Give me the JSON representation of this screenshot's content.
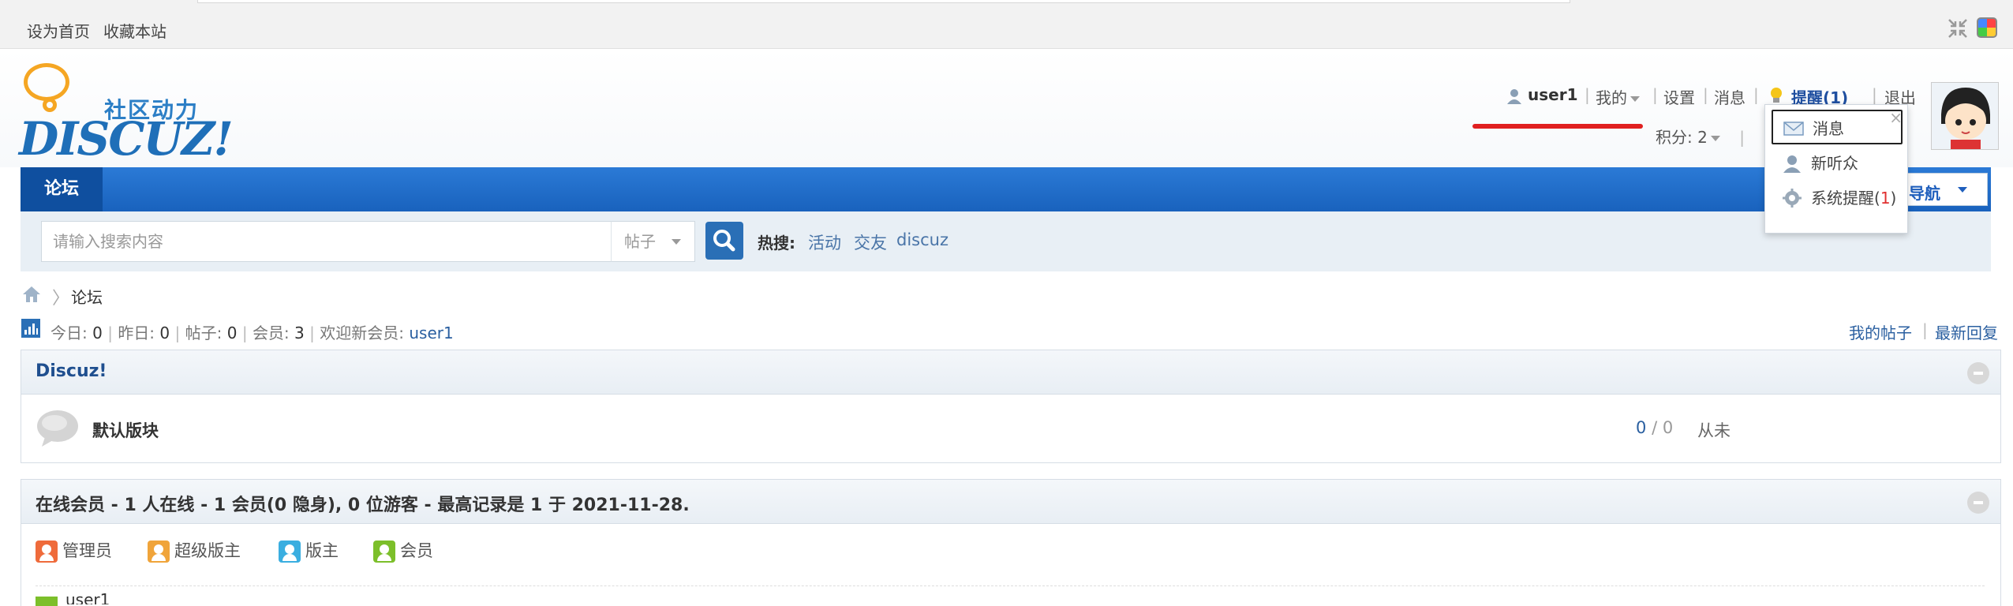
{
  "topbar": {
    "set_homepage": "设为首页",
    "bookmark": "收藏本站",
    "icons": [
      "shrink-icon",
      "style-switch-icon"
    ]
  },
  "logo": {
    "cn_text": "社区动力",
    "en_text": "DISCUZ!"
  },
  "userbar": {
    "username": "user1",
    "my": "我的",
    "settings": "设置",
    "messages": "消息",
    "remind": "提醒(1)",
    "logout": "退出",
    "separator": "|",
    "credits": "积分: 2"
  },
  "nav": {
    "tab": "论坛",
    "quick_nav": "导航"
  },
  "search": {
    "placeholder": "请输入搜索内容",
    "type": "帖子",
    "hot_label": "热搜:",
    "hot_terms": [
      "活动",
      "交友",
      "discuz"
    ]
  },
  "breadcrumb": {
    "arrow": "〉",
    "current": "论坛"
  },
  "stats": {
    "today_label": "今日:",
    "today": "0",
    "yesterday_label": "昨日:",
    "yesterday": "0",
    "posts_label": "帖子:",
    "posts": "0",
    "members_label": "会员:",
    "members": "3",
    "welcome_label": "欢迎新会员:",
    "newest_member": "user1",
    "my_posts": "我的帖子",
    "latest_replies": "最新回复"
  },
  "forum_group": {
    "title": "Discuz!",
    "forums": [
      {
        "name": "默认版块",
        "threads": "0",
        "posts": "0",
        "last": "从未"
      }
    ]
  },
  "online": {
    "title": "在线会员 - 1 人在线 - 1 会员(0 隐身), 0 位游客 - 最高记录是 1 于 2021-11-28.",
    "legend": [
      {
        "label": "管理员",
        "color": "#ef6b3b"
      },
      {
        "label": "超级版主",
        "color": "#f0a43a"
      },
      {
        "label": "版主",
        "color": "#3aaee0"
      },
      {
        "label": "会员",
        "color": "#7cbf2a"
      }
    ],
    "member_peek": "user1"
  },
  "popup": {
    "close": "×",
    "items": [
      {
        "label": "消息",
        "icon": "mail-icon"
      },
      {
        "label": "新听众",
        "icon": "person-icon"
      },
      {
        "label": "系统提醒",
        "count": "1",
        "icon": "gear-icon"
      }
    ]
  },
  "colors": {
    "nav_blue": "#1962bd",
    "underline_red": "#e02020",
    "link_blue": "#2a5fa0"
  }
}
